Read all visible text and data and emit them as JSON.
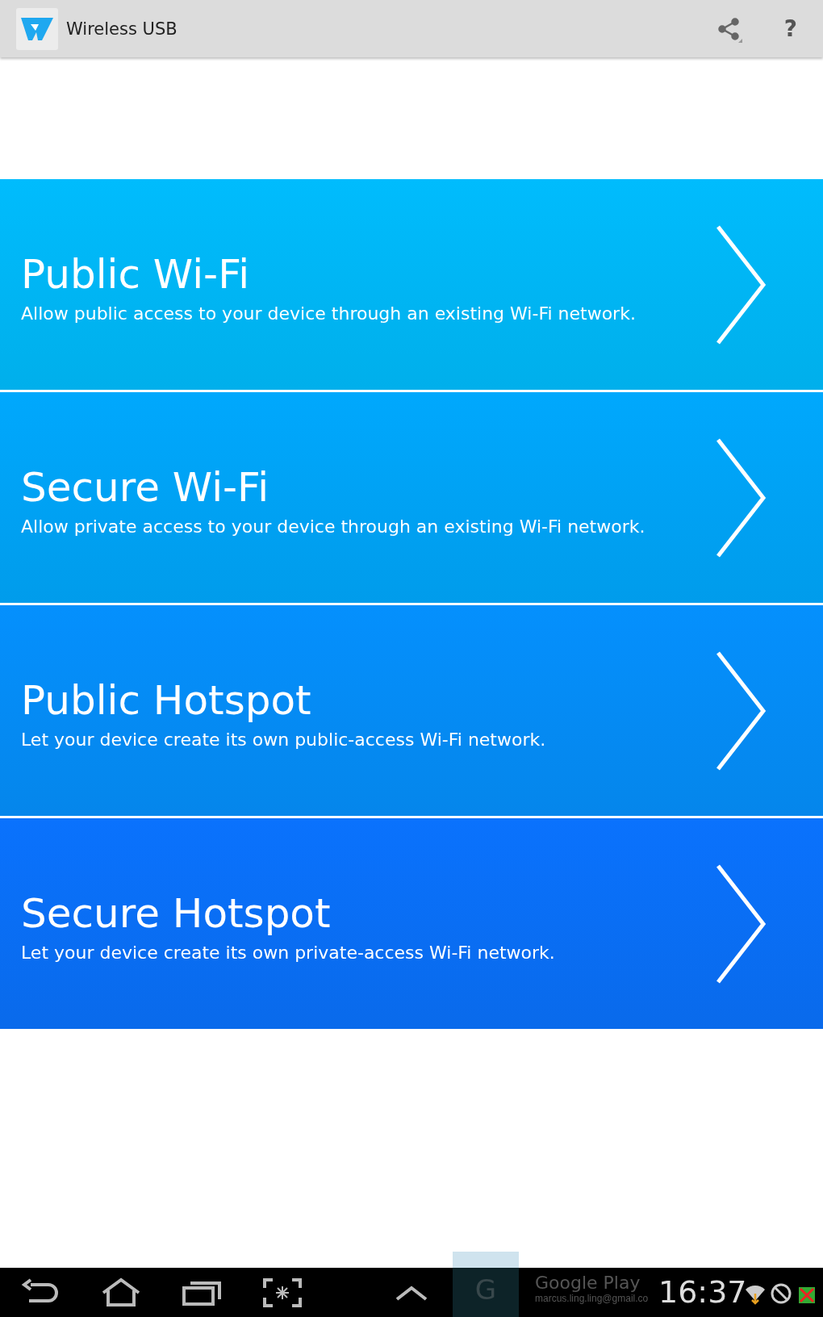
{
  "action_bar": {
    "title": "Wireless USB",
    "help": "?"
  },
  "options": [
    {
      "title": "Public Wi-Fi",
      "description": "Allow public access to your device through an existing Wi-Fi network.",
      "color": "#00bcfd"
    },
    {
      "title": "Secure Wi-Fi",
      "description": "Allow private access to your device through an existing Wi-Fi network.",
      "color": "#00a8fd"
    },
    {
      "title": "Public Hotspot",
      "description": "Let your device create its own public-access Wi-Fi network.",
      "color": "#0590fd"
    },
    {
      "title": "Secure Hotspot",
      "description": "Let your device create its own private-access Wi-Fi network.",
      "color": "#0a72fd"
    }
  ],
  "system_bar": {
    "app_letter": "G",
    "notification_title": "Google Play",
    "notification_text": "marcus.ling.ling@gmail.co",
    "time": "16:37"
  }
}
